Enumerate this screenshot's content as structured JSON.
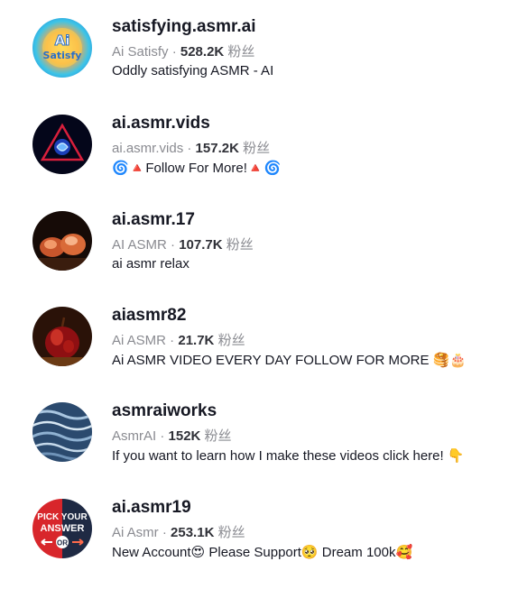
{
  "accounts": [
    {
      "username": "satisfying.asmr.ai",
      "nickname": "Ai Satisfy",
      "followers": "528.2K",
      "followers_label": "粉丝",
      "bio": "Oddly satisfying ASMR - AI",
      "avatar_text_line1": "Ai",
      "avatar_text_line2": "Satisfy"
    },
    {
      "username": "ai.asmr.vids",
      "nickname": "ai.asmr.vids",
      "followers": "157.2K",
      "followers_label": "粉丝",
      "bio": "🌀🔺Follow For More!🔺🌀"
    },
    {
      "username": "ai.asmr.17",
      "nickname": "AI ASMR",
      "followers": "107.7K",
      "followers_label": "粉丝",
      "bio": "ai asmr relax"
    },
    {
      "username": "aiasmr82",
      "nickname": "Ai ASMR",
      "followers": "21.7K",
      "followers_label": "粉丝",
      "bio": "Ai ASMR VIDEO EVERY DAY FOLLOW FOR MORE 🥞🎂"
    },
    {
      "username": "asmraiworks",
      "nickname": "AsmrAI",
      "followers": "152K",
      "followers_label": "粉丝",
      "bio": "If you want to learn how I make these videos click here! 👇"
    },
    {
      "username": "ai.asmr19",
      "nickname": "Ai Asmr",
      "followers": "253.1K",
      "followers_label": "粉丝",
      "bio": "New Account😍 Please Support🥺 Dream 100k🥰",
      "avatar_text_line1": "PICK YOUR",
      "avatar_text_line2": "ANSWER",
      "avatar_text_line3": "OR"
    }
  ],
  "separator": " · ",
  "colors": {
    "username": "#161823",
    "meta": "#8a8b91",
    "count": "#2f3037"
  }
}
